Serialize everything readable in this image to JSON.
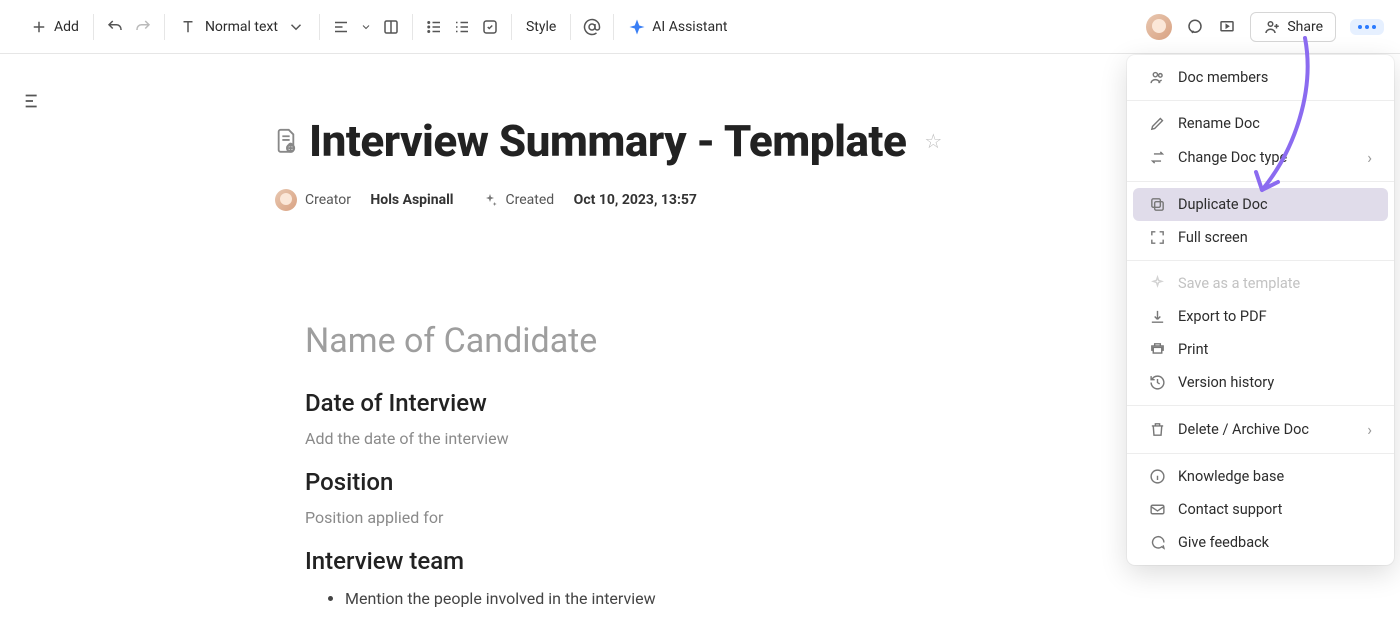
{
  "toolbar": {
    "add": "Add",
    "textStyle": "Normal text",
    "style": "Style",
    "ai": "AI Assistant",
    "share": "Share"
  },
  "doc": {
    "title": "Interview Summary - Template",
    "creatorLabel": "Creator",
    "creatorName": "Hols Aspinall",
    "createdLabel": "Created",
    "createdDate": "Oct 10, 2023, 13:57"
  },
  "content": {
    "nameHeading": "Name of Candidate",
    "dateHeading": "Date of Interview",
    "datePlaceholder": "Add the date of the interview",
    "positionHeading": "Position",
    "positionPlaceholder": "Position applied for",
    "teamHeading": "Interview team",
    "teamBullet": "Mention the people involved in the interview"
  },
  "menu": {
    "members": "Doc members",
    "rename": "Rename Doc",
    "changeType": "Change Doc type",
    "duplicate": "Duplicate Doc",
    "fullscreen": "Full screen",
    "saveTemplate": "Save as a template",
    "exportPdf": "Export to PDF",
    "print": "Print",
    "history": "Version history",
    "delete": "Delete / Archive Doc",
    "kb": "Knowledge base",
    "support": "Contact support",
    "feedback": "Give feedback"
  }
}
